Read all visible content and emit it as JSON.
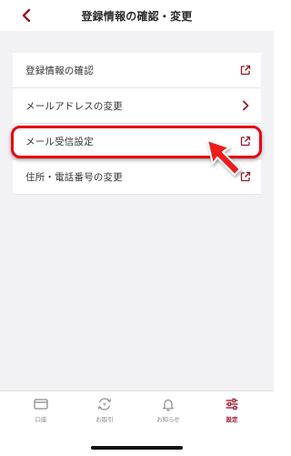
{
  "header": {
    "title": "登録情報の確認・変更"
  },
  "menu": {
    "items": [
      {
        "label": "登録情報の確認",
        "icon": "external-link-icon"
      },
      {
        "label": "メールアドレスの変更",
        "icon": "chevron-right-icon"
      },
      {
        "label": "メール受信設定",
        "icon": "external-link-icon"
      },
      {
        "label": "住所・電話番号の変更",
        "icon": "external-link-icon"
      }
    ]
  },
  "tabbar": {
    "tabs": [
      {
        "label": "口座",
        "icon": "card-icon"
      },
      {
        "label": "お取引",
        "icon": "exchange-icon"
      },
      {
        "label": "お知らせ",
        "icon": "bell-icon"
      },
      {
        "label": "設定",
        "icon": "settings-sliders-icon",
        "active": true
      }
    ]
  },
  "colors": {
    "accent": "#9a1425",
    "highlight": "#e60012"
  }
}
